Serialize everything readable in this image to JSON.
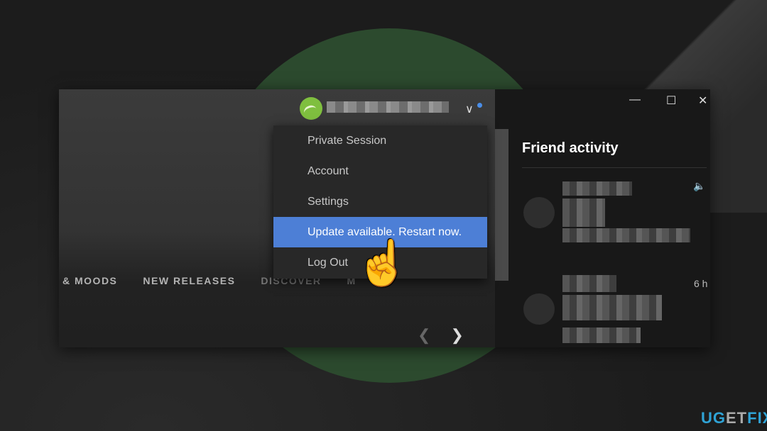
{
  "menu": {
    "items": [
      {
        "label": "Private Session"
      },
      {
        "label": "Account"
      },
      {
        "label": "Settings"
      },
      {
        "label": "Update available. Restart now.",
        "highlighted": true
      },
      {
        "label": "Log Out"
      }
    ]
  },
  "nav": {
    "tabs": [
      "& MOODS",
      "NEW RELEASES",
      "DISCOVER",
      "M"
    ]
  },
  "friends": {
    "title": "Friend activity",
    "time": "6 h"
  },
  "colors": {
    "accent": "#4d7fd6",
    "avatar": "#7fbf3f",
    "notify": "#4a8ee8"
  },
  "watermark": {
    "text": "UGETFIX",
    "part1": "UG",
    "part2": "ET",
    "part3": "FIX"
  }
}
